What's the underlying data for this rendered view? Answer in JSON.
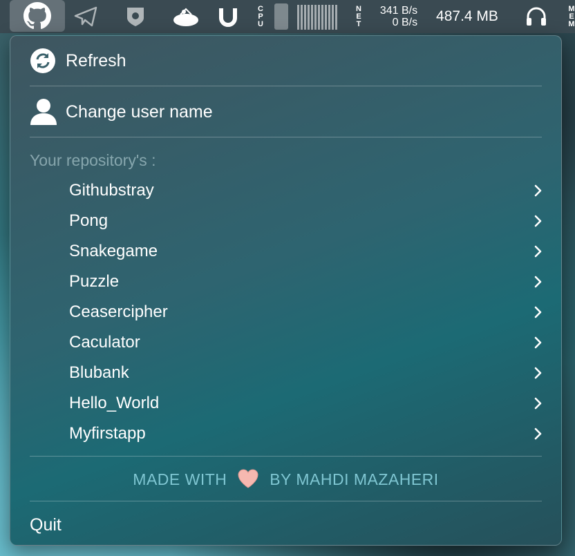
{
  "menubar": {
    "github_icon": "github-icon",
    "cpu_label": "CPU",
    "net_label": "NET",
    "net_up": "341 B/s",
    "net_down": "0 B/s",
    "memory": "487.4 MB",
    "mem_label_partial": "ME M"
  },
  "menu": {
    "refresh_label": "Refresh",
    "change_user_label": "Change user name",
    "section_label": "Your repository's :",
    "repositories": [
      {
        "name": "Githubstray"
      },
      {
        "name": "Pong"
      },
      {
        "name": "Snakegame"
      },
      {
        "name": "Puzzle"
      },
      {
        "name": "Ceasercipher"
      },
      {
        "name": "Caculator"
      },
      {
        "name": "Blubank"
      },
      {
        "name": "Hello_World"
      },
      {
        "name": "Myfirstapp"
      }
    ],
    "footer_before": "MADE WITH",
    "footer_after": "BY MAHDI MAZAHERI",
    "quit_label": "Quit"
  },
  "colors": {
    "footer": "#7fc6d2",
    "heart": "#f6b8b0"
  }
}
